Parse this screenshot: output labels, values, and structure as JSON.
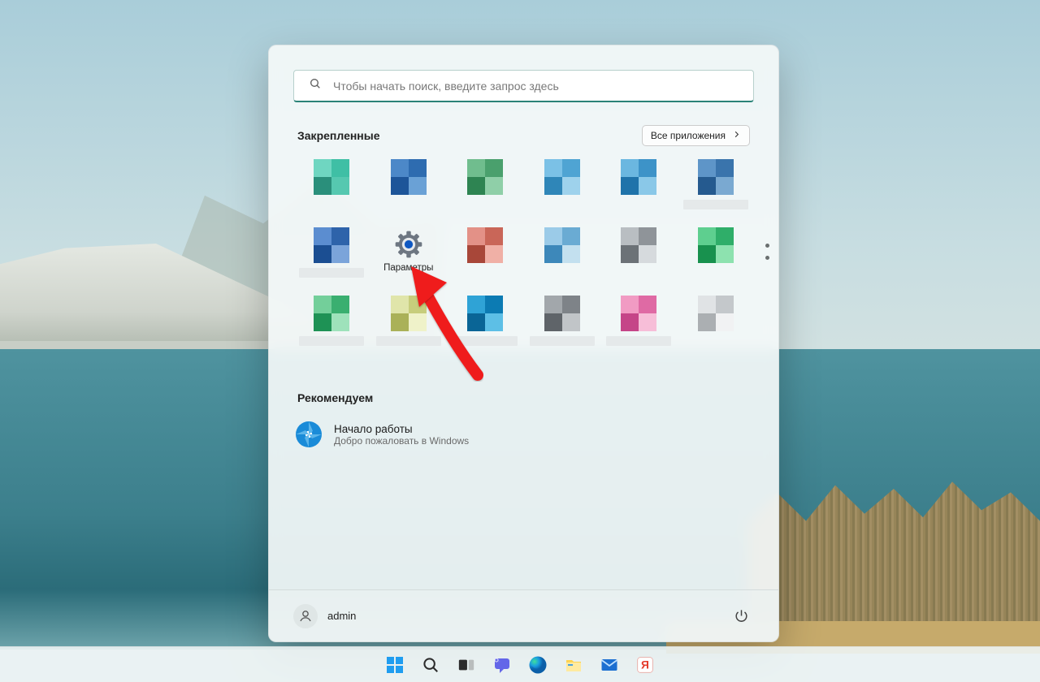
{
  "search": {
    "placeholder": "Чтобы начать поиск, введите запрос здесь"
  },
  "pinned": {
    "title": "Закрепленные",
    "all_apps_label": "Все приложения"
  },
  "tiles": [
    {
      "c": [
        "#6fd6c1",
        "#3fbfa5",
        "#2a8f7b",
        "#56c8b0"
      ],
      "label": false
    },
    {
      "c": [
        "#4c88c8",
        "#2e6cb0",
        "#1d5599",
        "#6aa1d6"
      ],
      "label": false
    },
    {
      "c": [
        "#70bd8e",
        "#4aa06d",
        "#2e8452",
        "#8fcfa8"
      ],
      "label": false
    },
    {
      "c": [
        "#7bc1e6",
        "#4fa4d3",
        "#2f86b8",
        "#9ed2ec"
      ],
      "label": false
    },
    {
      "c": [
        "#6bb7e0",
        "#3d93c8",
        "#1f73aa",
        "#8ac8e8"
      ],
      "label": false
    },
    {
      "c": [
        "#5e95c8",
        "#3a74ac",
        "#255a8f",
        "#7aa9d1"
      ],
      "label": true
    },
    {
      "c": [
        "#5b8dd0",
        "#2e63aa",
        "#1b4e92",
        "#7ba4da"
      ],
      "label": true
    },
    {
      "settings": true,
      "text": "Параметры"
    },
    {
      "c": [
        "#e39187",
        "#c96658",
        "#a84739",
        "#f0b0a6"
      ],
      "label": false
    },
    {
      "c": [
        "#9bcbe8",
        "#6aabd3",
        "#3d88ba",
        "#c3e0ef"
      ],
      "label": false
    },
    {
      "c": [
        "#b9bec2",
        "#8f9499",
        "#6c7277",
        "#d6dadd"
      ],
      "label": false
    },
    {
      "c": [
        "#5ecf8f",
        "#2fae69",
        "#18914e",
        "#8de2af"
      ],
      "label": false
    },
    {
      "c": [
        "#73cf9a",
        "#3aaf70",
        "#1e9255",
        "#9ee2bb"
      ],
      "label": true
    },
    {
      "c": [
        "#e0e5aa",
        "#c7cd7c",
        "#aab158",
        "#eff2c9"
      ],
      "label": true
    },
    {
      "c": [
        "#2fa3d6",
        "#0c7bb3",
        "#0a6596",
        "#5dbfe6"
      ],
      "label": true
    },
    {
      "c": [
        "#a2a7ab",
        "#7e8388",
        "#5f6469",
        "#c1c5c8"
      ],
      "label": true
    },
    {
      "c": [
        "#f19bc3",
        "#df6aa4",
        "#c54588",
        "#f7bed8"
      ],
      "label": true
    },
    {
      "c": [
        "#e0e3e5",
        "#c4c8cb",
        "#abafb2",
        "#f1f2f3"
      ],
      "label": false
    }
  ],
  "recommended": {
    "title": "Рекомендуем",
    "items": [
      {
        "title": "Начало работы",
        "subtitle": "Добро пожаловать в Windows"
      }
    ]
  },
  "footer": {
    "username": "admin"
  },
  "taskbar": {
    "items": [
      "start",
      "search",
      "taskview",
      "chat",
      "edge",
      "explorer",
      "mail",
      "yandex"
    ]
  }
}
